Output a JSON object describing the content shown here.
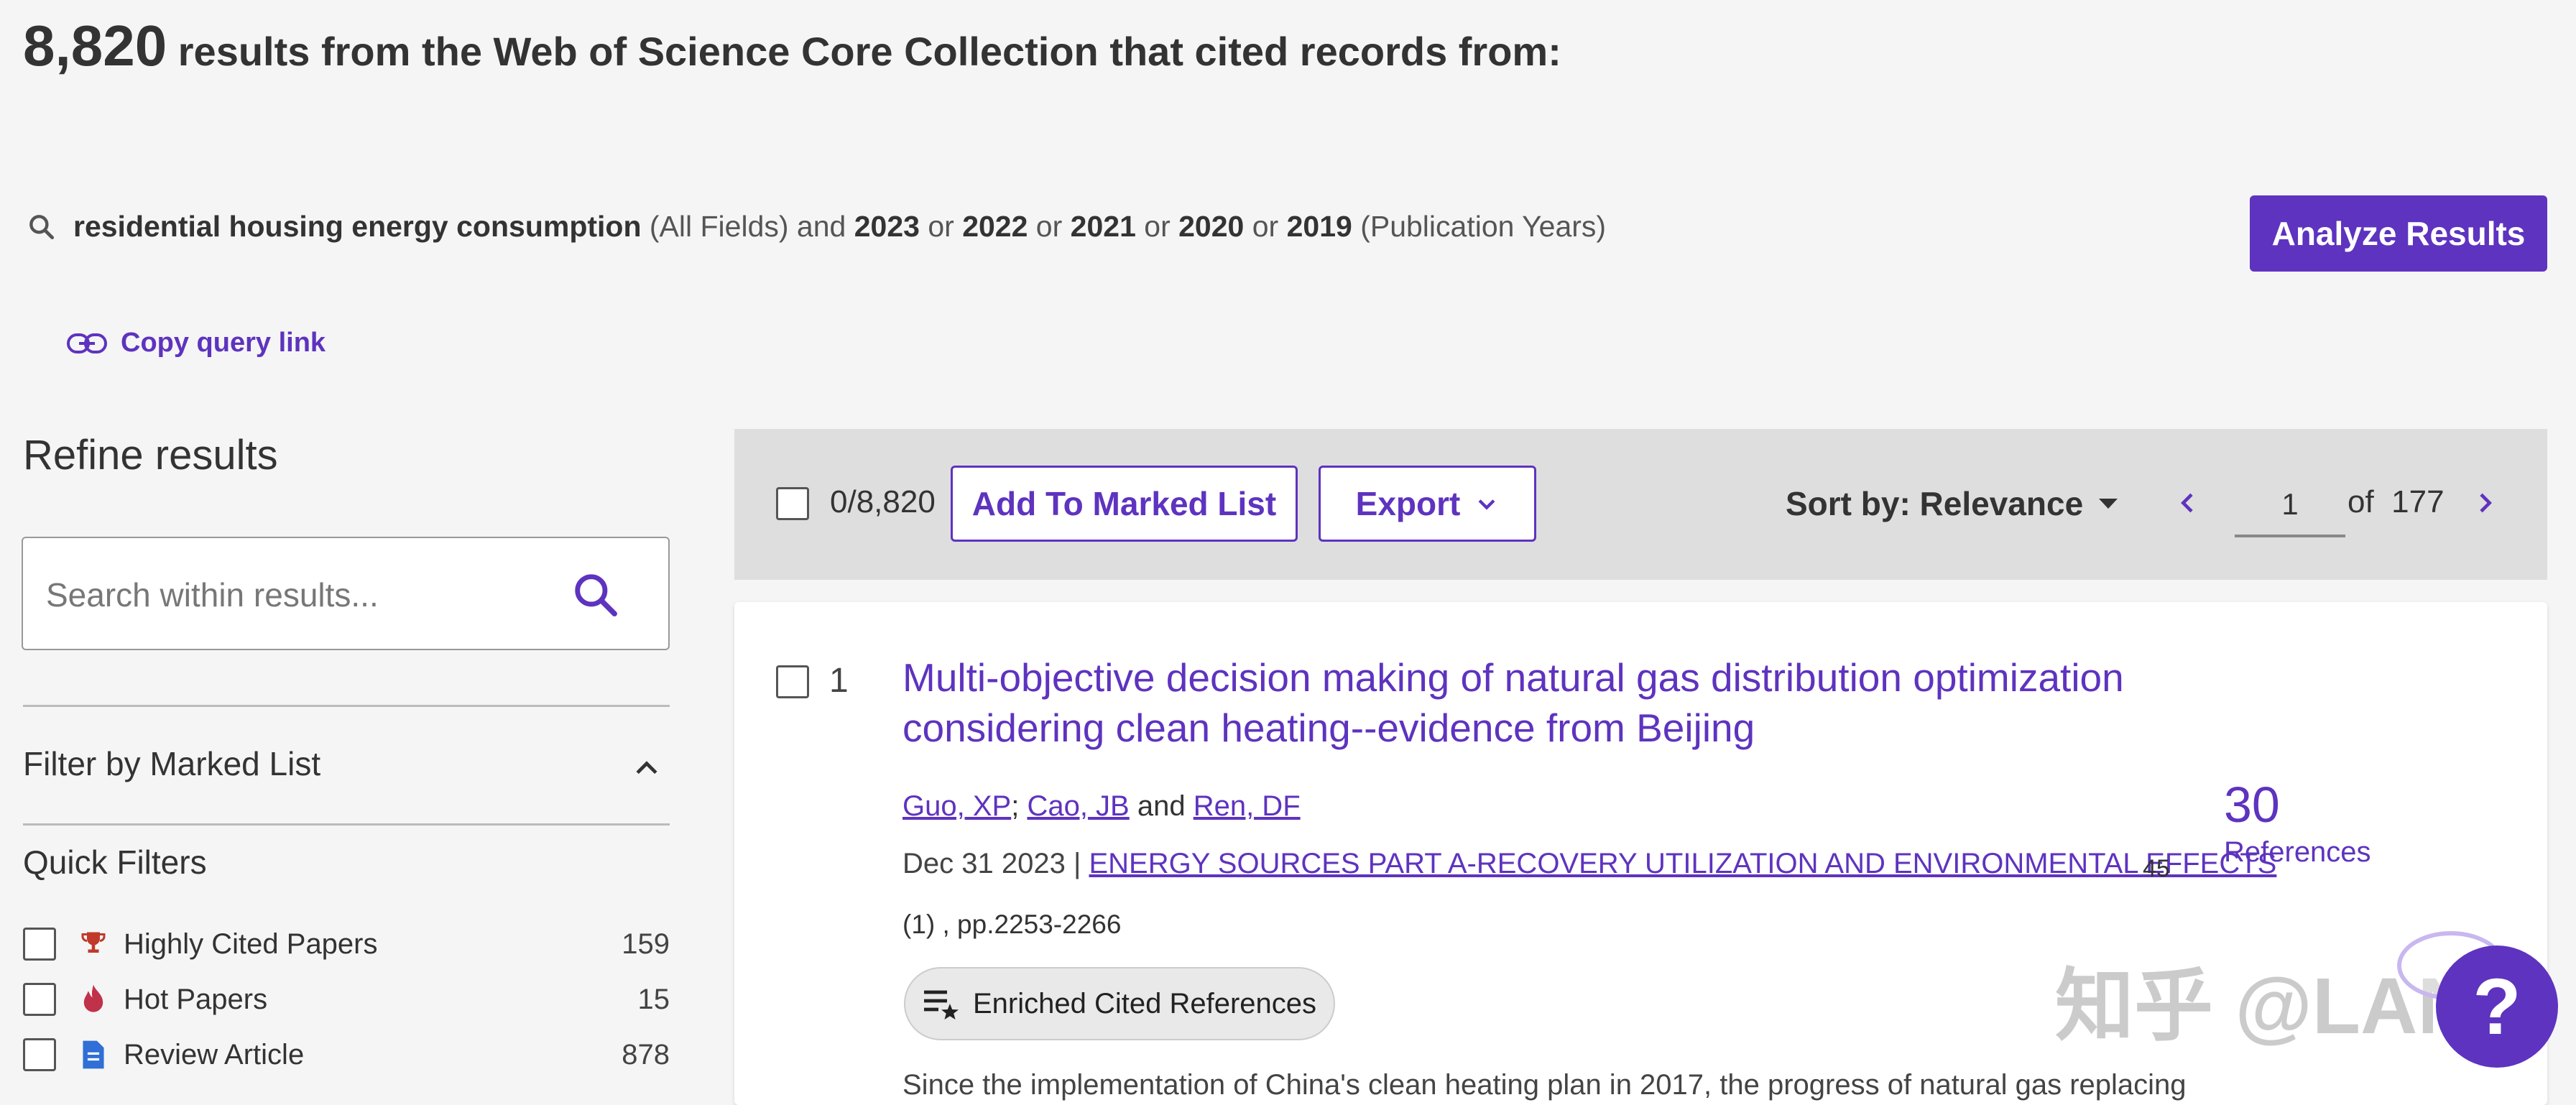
{
  "header": {
    "count": "8,820",
    "headline_rest": " results from the Web of Science Core Collection that cited records from:"
  },
  "query": {
    "terms": "residential housing energy consumption",
    "fields": " (All Fields) and ",
    "year1": "2023",
    "or1": " or ",
    "year2": "2022",
    "or2": " or ",
    "year3": "2021",
    "or3": " or ",
    "year4": "2020",
    "or4": " or ",
    "year5": "2019",
    "years_label": " (Publication Years)"
  },
  "analyze_label": "Analyze Results",
  "copy_link_label": "Copy query link",
  "sidebar": {
    "refine_title": "Refine results",
    "search_placeholder": "Search within results...",
    "filter_marked_label": "Filter by Marked List",
    "quick_filters_label": "Quick Filters",
    "quick_filters": [
      {
        "label": "Highly Cited Papers",
        "count": "159",
        "icon": "trophy-icon"
      },
      {
        "label": "Hot Papers",
        "count": "15",
        "icon": "flame-icon"
      },
      {
        "label": "Review Article",
        "count": "878",
        "icon": "document-icon"
      }
    ]
  },
  "toolbar": {
    "selected": "0/8,820",
    "add_marked_label": "Add To Marked List",
    "export_label": "Export",
    "sort_label": "Sort by: Relevance",
    "page_value": "1",
    "page_of": "of  177"
  },
  "record": {
    "number": "1",
    "title": "Multi-objective decision making of natural gas distribution optimization considering clean heating--evidence from Beijing",
    "author1": "Guo, XP",
    "sep1": "; ",
    "author2": "Cao, JB",
    "sep2": " and ",
    "author3": "Ren, DF",
    "date": "Dec 31 2023 | ",
    "journal": "ENERGY SOURCES PART A-RECOVERY UTILIZATION AND ENVIRONMENTAL EFFECTS",
    "volume": "45",
    "pages": "(1) , pp.2253-2266",
    "ref_count": "30",
    "ref_label": "References",
    "enriched_label": "Enriched Cited References",
    "abstract": "Since the implementation of China's clean heating plan in 2017, the progress of natural gas replacing"
  },
  "watermark": "知乎 @LANN",
  "colors": {
    "accent": "#5e33bf",
    "background": "#f5f5f5",
    "toolbar": "#dedede"
  }
}
